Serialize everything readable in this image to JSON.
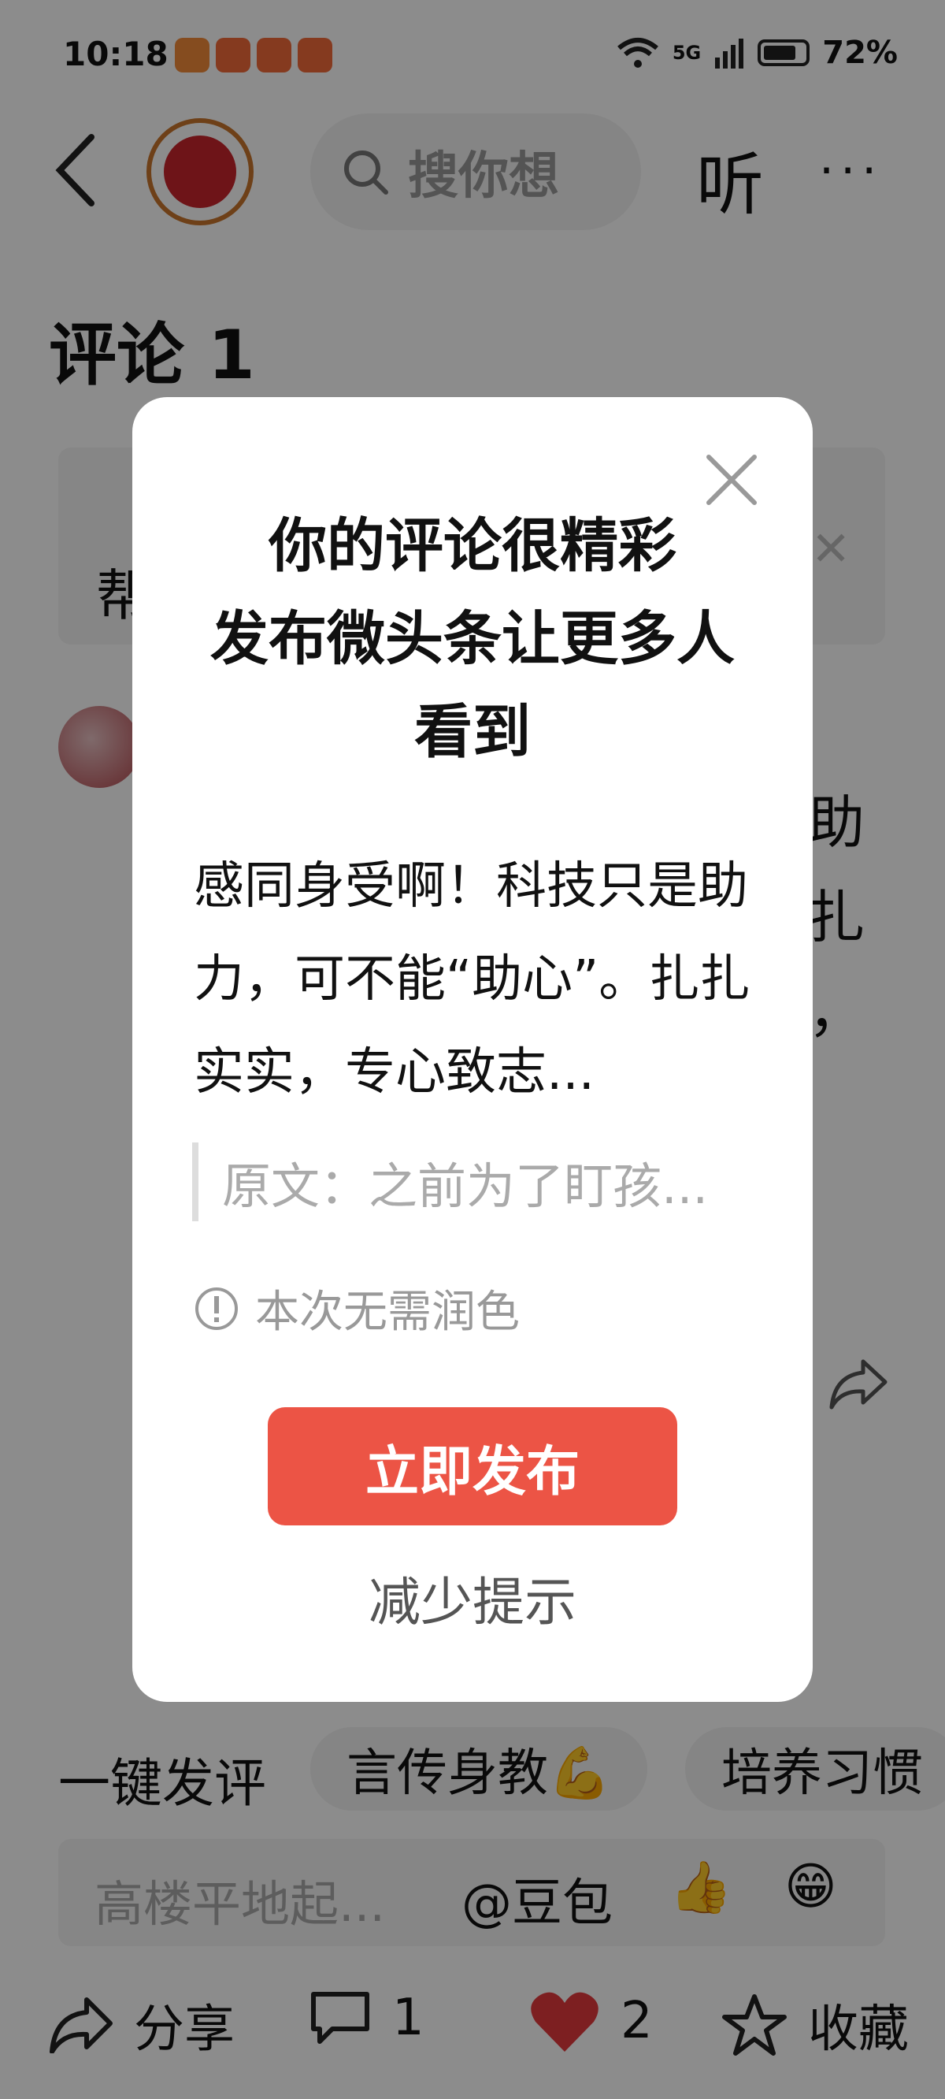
{
  "status_bar": {
    "time": "10:18",
    "network": "5G",
    "battery": "72%"
  },
  "header": {
    "search_placeholder": "搜你想",
    "listen_label": "听",
    "more_label": "···"
  },
  "page": {
    "comments_title": "评论 1",
    "help_text": "帮",
    "comment_visible_text": "助\n扎\n，"
  },
  "quick_reply": {
    "label": "一键发评",
    "chips": [
      "言传身教💪",
      "培养习惯"
    ],
    "input_placeholder": "高楼平地起...",
    "mention": "@豆包",
    "emojis": [
      "👍",
      "😁"
    ]
  },
  "bottom_bar": {
    "share": "分享",
    "comments_count": "1",
    "likes_count": "2",
    "favorite": "收藏"
  },
  "modal": {
    "title": "你的评论很精彩\n发布微头条让更多人\n看到",
    "body": "感同身受啊！科技只是助力，可不能“助心”。扎扎实实，专心致志...",
    "quote": "原文：之前为了盯孩...",
    "notice": "本次无需润色",
    "publish_button": "立即发布",
    "reduce_label": "减少提示"
  }
}
